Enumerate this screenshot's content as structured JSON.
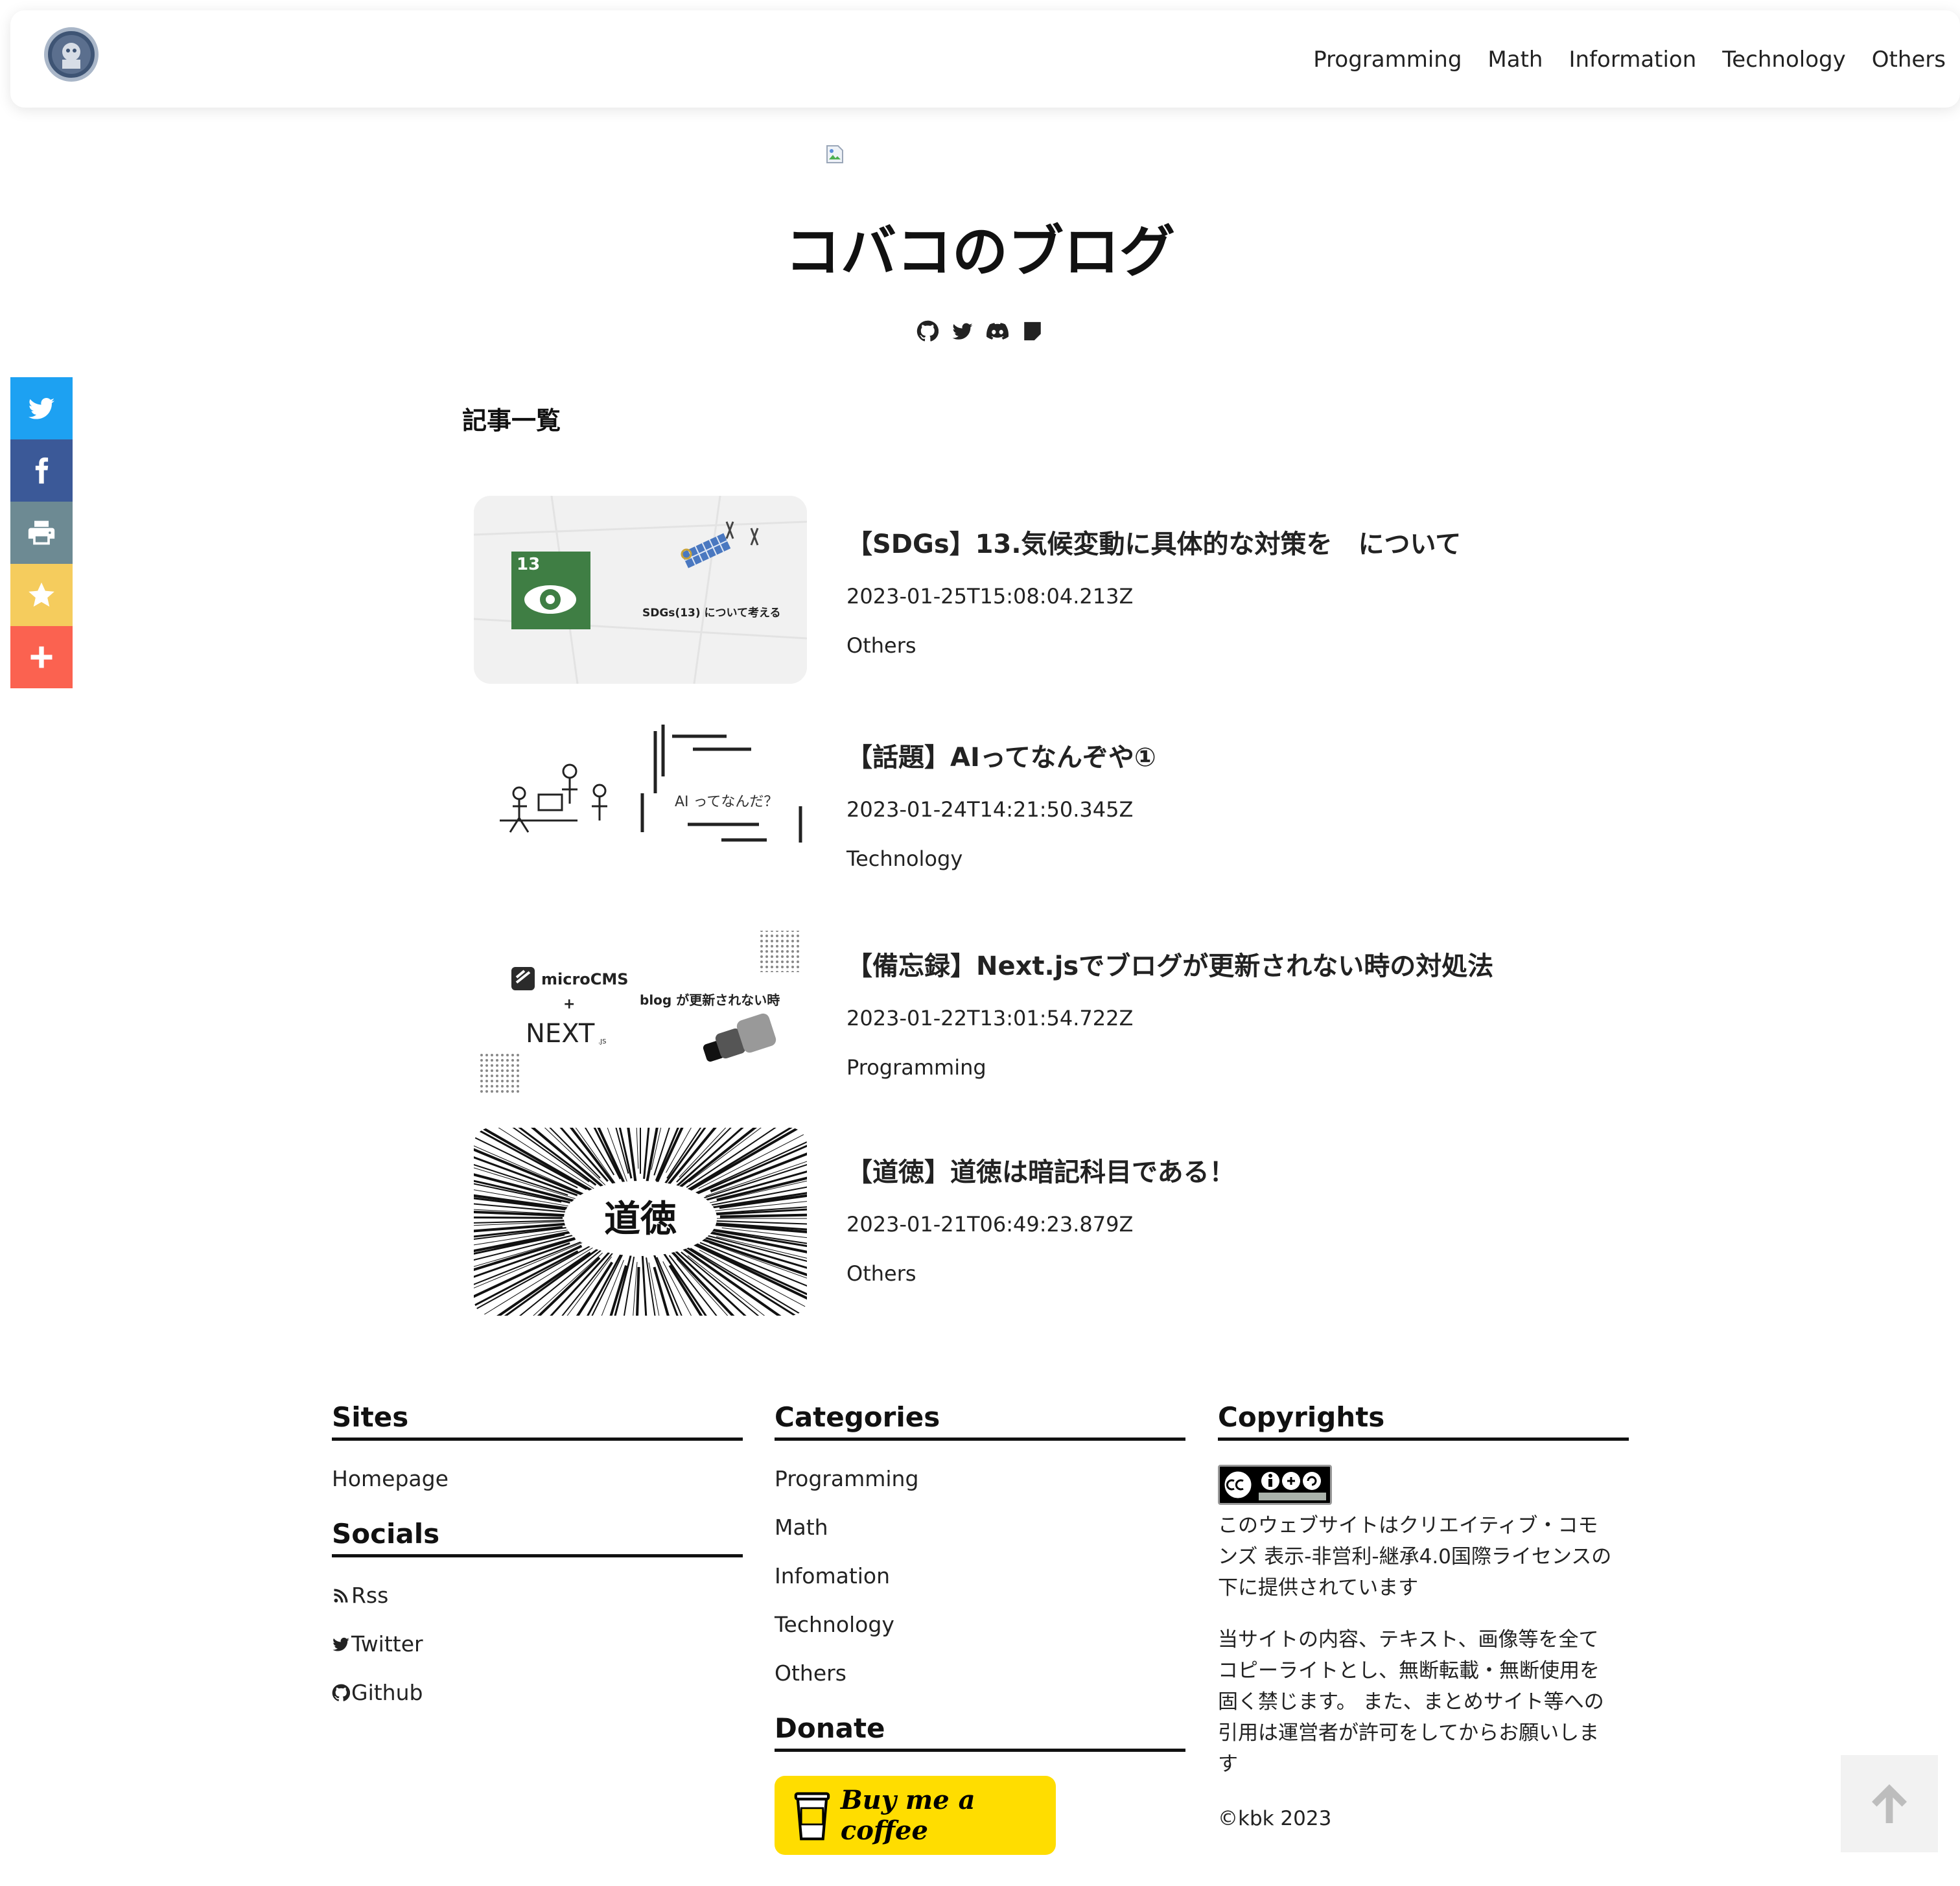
{
  "header": {
    "nav": [
      "Programming",
      "Math",
      "Information",
      "Technology",
      "Others"
    ]
  },
  "share": {
    "colors": {
      "twitter": "#1da1f2",
      "facebook": "#3b5998",
      "print": "#6d8a93",
      "favorite": "#f5cc5d",
      "more": "#fb6250"
    }
  },
  "hero": {
    "title": "コバコのブログ",
    "icons": [
      "github-icon",
      "twitter-icon",
      "discord-icon",
      "note-icon"
    ]
  },
  "section_heading": "記事一覧",
  "articles": [
    {
      "title": "【SDGs】13.気候変動に具体的な対策を　について",
      "date": "2023-01-25T15:08:04.213Z",
      "category": "Others",
      "thumb_text": "SDGs(13) について考える"
    },
    {
      "title": "【話題】AIってなんぞや①",
      "date": "2023-01-24T14:21:50.345Z",
      "category": "Technology",
      "thumb_text": "AI ってなんだ？"
    },
    {
      "title": "【備忘録】Next.jsでブログが更新されない時の対処法",
      "date": "2023-01-22T13:01:54.722Z",
      "category": "Programming",
      "thumb_text": "blog が更新されない時",
      "thumb_brand1": "microCMS",
      "thumb_plus": "+",
      "thumb_brand2": "NEXT",
      "thumb_brand2_sub": ".JS"
    },
    {
      "title": "【道徳】道徳は暗記科目である！",
      "date": "2023-01-21T06:49:23.879Z",
      "category": "Others",
      "thumb_text": "道徳"
    }
  ],
  "footer": {
    "sites": {
      "heading": "Sites",
      "links": [
        "Homepage"
      ]
    },
    "socials": {
      "heading": "Socials",
      "links": [
        "Rss",
        "Twitter",
        "Github"
      ]
    },
    "categories": {
      "heading": "Categories",
      "links": [
        "Programming",
        "Math",
        "Infomation",
        "Technology",
        "Others"
      ]
    },
    "donate": {
      "heading": "Donate",
      "button": "Buy me a coffee"
    },
    "copyrights": {
      "heading": "Copyrights",
      "cc_lines": [
        "このウェブサイトはクリエイティブ・コモ",
        "ンズ 表示-非営利-継承4.0国際ライセンスの",
        "下に提供されています"
      ],
      "notice_lines": [
        "当サイトの内容、テキスト、画像等を全て",
        "コピーライトとし、無断転載・無断使用を",
        "固く禁じます。 また、まとめサイト等への",
        "引用は運営者が許可をしてからお願いしま",
        "す"
      ],
      "copyright": "©kbk 2023"
    }
  }
}
